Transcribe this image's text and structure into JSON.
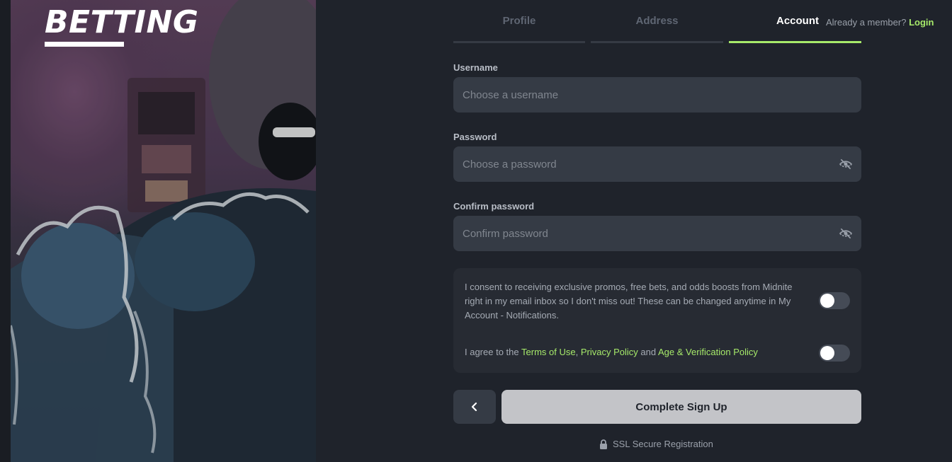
{
  "brand": {
    "title": "BETTING"
  },
  "tabs": [
    {
      "label": "Profile",
      "active": false
    },
    {
      "label": "Address",
      "active": false
    },
    {
      "label": "Account",
      "active": true
    }
  ],
  "member": {
    "prompt": "Already a member?",
    "login": "Login"
  },
  "form": {
    "username": {
      "label": "Username",
      "placeholder": "Choose a username"
    },
    "password": {
      "label": "Password",
      "placeholder": "Choose a password",
      "icon": "eye-off-icon"
    },
    "confirm": {
      "label": "Confirm password",
      "placeholder": "Confirm password",
      "icon": "eye-off-icon"
    }
  },
  "consent": {
    "promo_text": "I consent to receiving exclusive promos, free bets, and odds boosts from Midnite right in my email inbox so I don't miss out! These can be changed anytime in My Account - Notifications.",
    "promo_on": false,
    "agree_prefix": "I agree to the",
    "terms": "Terms of Use",
    "comma": ",",
    "privacy": "Privacy Policy",
    "and": "and",
    "age": "Age & Verification Policy",
    "agree_on": false
  },
  "actions": {
    "back_icon": "chevron-left-icon",
    "submit": "Complete Sign Up"
  },
  "footer": {
    "ssl": "SSL Secure Registration",
    "icon": "lock-icon"
  },
  "colors": {
    "background": "#1f232b",
    "accent": "#a6e96a",
    "field": "#353b45",
    "button": "#c3c4c8"
  }
}
